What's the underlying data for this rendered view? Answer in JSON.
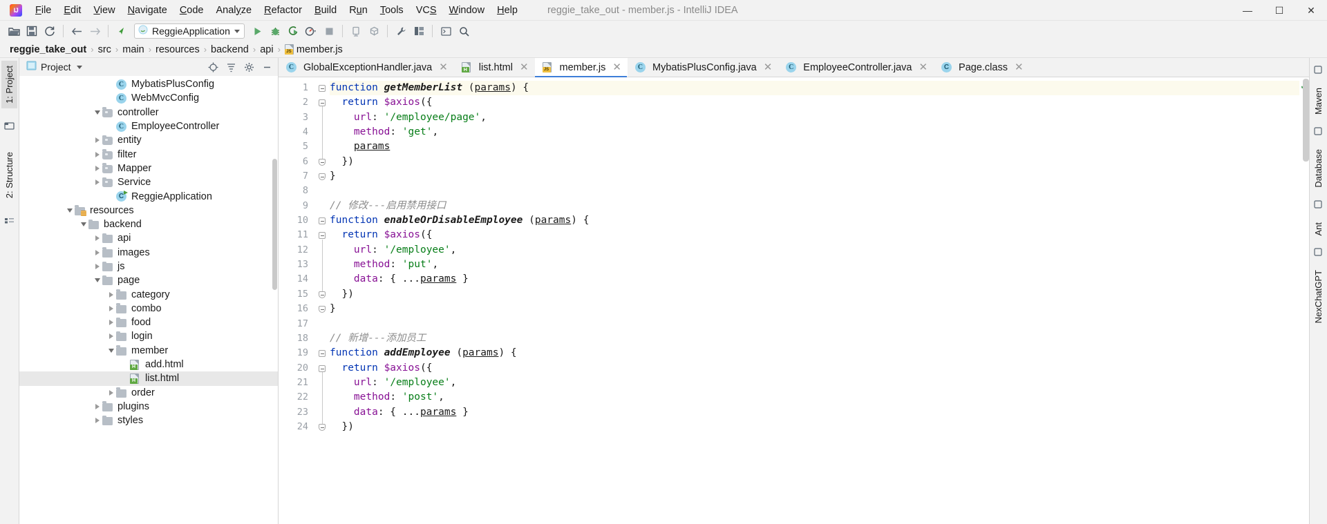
{
  "window": {
    "title": "reggie_take_out - member.js - IntelliJ IDEA",
    "logo_icon": "intellij-idea-logo",
    "minimize_label": "—",
    "maximize_label": "☐",
    "close_label": "✕"
  },
  "menubar": [
    {
      "label": "File"
    },
    {
      "label": "Edit"
    },
    {
      "label": "View"
    },
    {
      "label": "Navigate"
    },
    {
      "label": "Code"
    },
    {
      "label": "Analyze"
    },
    {
      "label": "Refactor"
    },
    {
      "label": "Build"
    },
    {
      "label": "Run"
    },
    {
      "label": "Tools"
    },
    {
      "label": "VCS"
    },
    {
      "label": "Window"
    },
    {
      "label": "Help"
    }
  ],
  "toolbar": {
    "open_icon": "open-folder-icon",
    "save_icon": "save-disk-icon",
    "sync_icon": "refresh-sync-icon",
    "back_icon": "back-arrow-icon",
    "forward_icon": "forward-arrow-icon",
    "pointer_icon": "cursor-arrow-icon",
    "run_config": "ReggieApplication",
    "run_config_icon": "spring-boot-icon",
    "run_icon": "run-play-icon",
    "debug_icon": "debug-bug-icon",
    "run_coverage_icon": "run-with-coverage-icon",
    "profile_icon": "profiler-icon",
    "stop_icon": "stop-square-icon",
    "device_icon": "device-manager-icon",
    "sdk_icon": "sdk-package-icon",
    "settings_icon": "wrench-settings-icon",
    "project_structure_icon": "project-structure-icon",
    "terminal_icon": "terminal-icon",
    "search_icon": "search-magnifier-icon"
  },
  "breadcrumb": {
    "separator": "›",
    "items": [
      {
        "label": "reggie_take_out",
        "bold": true,
        "icon": ""
      },
      {
        "label": "src",
        "bold": false,
        "icon": ""
      },
      {
        "label": "main",
        "bold": false,
        "icon": ""
      },
      {
        "label": "resources",
        "bold": false,
        "icon": ""
      },
      {
        "label": "backend",
        "bold": false,
        "icon": ""
      },
      {
        "label": "api",
        "bold": false,
        "icon": ""
      },
      {
        "label": "member.js",
        "bold": false,
        "icon": "js-file-icon"
      }
    ]
  },
  "left_strip": {
    "tabs": [
      {
        "label": "1: Project",
        "active": true
      },
      {
        "label": "2: Structure",
        "active": false
      }
    ],
    "favorites_icon": "favorites-star-icon",
    "bottom_icon": "build-variants-icon"
  },
  "right_strip": {
    "tabs": [
      {
        "label": "Maven",
        "icon": "maven-icon"
      },
      {
        "label": "Database",
        "icon": "database-icon"
      },
      {
        "label": "Ant",
        "icon": "ant-icon"
      },
      {
        "label": "NexChatGPT",
        "icon": "chatgpt-icon"
      }
    ]
  },
  "project_panel": {
    "title": "Project",
    "dropdown_icon": "chevron-down-icon",
    "locate_icon": "scroll-from-source-icon",
    "collapse_icon": "collapse-all-icon",
    "settings_icon": "gear-icon",
    "hide_icon": "hide-panel-icon",
    "tree": [
      {
        "label": "MybatisPlusConfig",
        "indent": 6,
        "icon": "java-class-icon",
        "twist": "none",
        "selected": false
      },
      {
        "label": "WebMvcConfig",
        "indent": 6,
        "icon": "java-class-icon",
        "twist": "none",
        "selected": false
      },
      {
        "label": "controller",
        "indent": 5,
        "icon": "folder-icon",
        "twist": "down",
        "selected": false
      },
      {
        "label": "EmployeeController",
        "indent": 6,
        "icon": "java-class-icon",
        "twist": "none",
        "selected": false
      },
      {
        "label": "entity",
        "indent": 5,
        "icon": "folder-icon",
        "twist": "right",
        "selected": false
      },
      {
        "label": "filter",
        "indent": 5,
        "icon": "folder-icon",
        "twist": "right",
        "selected": false
      },
      {
        "label": "Mapper",
        "indent": 5,
        "icon": "folder-icon",
        "twist": "right",
        "selected": false
      },
      {
        "label": "Service",
        "indent": 5,
        "icon": "folder-icon",
        "twist": "right",
        "selected": false
      },
      {
        "label": "ReggieApplication",
        "indent": 6,
        "icon": "spring-boot-icon",
        "twist": "none",
        "selected": false
      },
      {
        "label": "resources",
        "indent": 3,
        "icon": "resources-folder-icon",
        "twist": "down",
        "selected": false
      },
      {
        "label": "backend",
        "indent": 4,
        "icon": "folder-plain-icon",
        "twist": "down",
        "selected": false
      },
      {
        "label": "api",
        "indent": 5,
        "icon": "folder-plain-icon",
        "twist": "right",
        "selected": false
      },
      {
        "label": "images",
        "indent": 5,
        "icon": "folder-plain-icon",
        "twist": "right",
        "selected": false
      },
      {
        "label": "js",
        "indent": 5,
        "icon": "folder-plain-icon",
        "twist": "right",
        "selected": false
      },
      {
        "label": "page",
        "indent": 5,
        "icon": "folder-plain-icon",
        "twist": "down",
        "selected": false
      },
      {
        "label": "category",
        "indent": 6,
        "icon": "folder-plain-icon",
        "twist": "right",
        "selected": false
      },
      {
        "label": "combo",
        "indent": 6,
        "icon": "folder-plain-icon",
        "twist": "right",
        "selected": false
      },
      {
        "label": "food",
        "indent": 6,
        "icon": "folder-plain-icon",
        "twist": "right",
        "selected": false
      },
      {
        "label": "login",
        "indent": 6,
        "icon": "folder-plain-icon",
        "twist": "right",
        "selected": false
      },
      {
        "label": "member",
        "indent": 6,
        "icon": "folder-plain-icon",
        "twist": "down",
        "selected": false
      },
      {
        "label": "add.html",
        "indent": 7,
        "icon": "html-file-icon",
        "twist": "none",
        "selected": false
      },
      {
        "label": "list.html",
        "indent": 7,
        "icon": "html-file-icon",
        "twist": "none",
        "selected": true
      },
      {
        "label": "order",
        "indent": 6,
        "icon": "folder-plain-icon",
        "twist": "right",
        "selected": false
      },
      {
        "label": "plugins",
        "indent": 5,
        "icon": "folder-plain-icon",
        "twist": "right",
        "selected": false
      },
      {
        "label": "styles",
        "indent": 5,
        "icon": "folder-plain-icon",
        "twist": "right",
        "selected": false
      }
    ]
  },
  "editor": {
    "tabs": [
      {
        "label": "GlobalExceptionHandler.java",
        "icon": "java-class-icon",
        "active": false,
        "close_label": "✕"
      },
      {
        "label": "list.html",
        "icon": "html-file-icon",
        "active": false,
        "close_label": "✕"
      },
      {
        "label": "member.js",
        "icon": "js-file-icon",
        "active": true,
        "close_label": "✕"
      },
      {
        "label": "MybatisPlusConfig.java",
        "icon": "java-class-icon",
        "active": false,
        "close_label": "✕"
      },
      {
        "label": "EmployeeController.java",
        "icon": "java-class-icon",
        "active": false,
        "close_label": "✕"
      },
      {
        "label": "Page.class",
        "icon": "class-file-icon",
        "active": false,
        "close_label": "✕"
      }
    ],
    "inspection_status_icon": "inspection-ok-check",
    "first_line_number": 1,
    "lines": [
      {
        "n": 1,
        "fold": "minus",
        "highlight": true,
        "tokens": [
          {
            "t": "function ",
            "c": "kw"
          },
          {
            "t": "getMemberList",
            "c": "fn"
          },
          {
            "t": " (",
            "c": "pn"
          },
          {
            "t": "params",
            "c": "pm"
          },
          {
            "t": ") {",
            "c": "pn"
          }
        ],
        "indent": 0
      },
      {
        "n": 2,
        "fold": "minus",
        "highlight": false,
        "tokens": [
          {
            "t": "  return ",
            "c": "kw2"
          },
          {
            "t": "$axios",
            "c": "var"
          },
          {
            "t": "({",
            "c": "pn"
          }
        ],
        "indent": 0
      },
      {
        "n": 3,
        "fold": "",
        "highlight": false,
        "tokens": [
          {
            "t": "    ",
            "c": "pn"
          },
          {
            "t": "url",
            "c": "prop"
          },
          {
            "t": ": ",
            "c": "pn"
          },
          {
            "t": "'/employee/page'",
            "c": "str"
          },
          {
            "t": ",",
            "c": "pn"
          }
        ],
        "indent": 0
      },
      {
        "n": 4,
        "fold": "",
        "highlight": false,
        "tokens": [
          {
            "t": "    ",
            "c": "pn"
          },
          {
            "t": "method",
            "c": "prop"
          },
          {
            "t": ": ",
            "c": "pn"
          },
          {
            "t": "'get'",
            "c": "str"
          },
          {
            "t": ",",
            "c": "pn"
          }
        ],
        "indent": 0
      },
      {
        "n": 5,
        "fold": "",
        "highlight": false,
        "tokens": [
          {
            "t": "    ",
            "c": "pn"
          },
          {
            "t": "params",
            "c": "pm"
          }
        ],
        "indent": 0
      },
      {
        "n": 6,
        "fold": "minus-end",
        "highlight": false,
        "tokens": [
          {
            "t": "  })",
            "c": "pn"
          }
        ],
        "indent": 0
      },
      {
        "n": 7,
        "fold": "minus-end",
        "highlight": false,
        "tokens": [
          {
            "t": "}",
            "c": "pn"
          }
        ],
        "indent": 0
      },
      {
        "n": 8,
        "fold": "",
        "highlight": false,
        "tokens": [],
        "indent": 0
      },
      {
        "n": 9,
        "fold": "",
        "highlight": false,
        "tokens": [
          {
            "t": "// 修改---启用禁用接口",
            "c": "cmt"
          }
        ],
        "indent": 0
      },
      {
        "n": 10,
        "fold": "minus",
        "highlight": false,
        "tokens": [
          {
            "t": "function ",
            "c": "kw"
          },
          {
            "t": "enableOrDisableEmployee",
            "c": "fn"
          },
          {
            "t": " (",
            "c": "pn"
          },
          {
            "t": "params",
            "c": "pm"
          },
          {
            "t": ") {",
            "c": "pn"
          }
        ],
        "indent": 0
      },
      {
        "n": 11,
        "fold": "minus",
        "highlight": false,
        "tokens": [
          {
            "t": "  return ",
            "c": "kw2"
          },
          {
            "t": "$axios",
            "c": "var"
          },
          {
            "t": "({",
            "c": "pn"
          }
        ],
        "indent": 0
      },
      {
        "n": 12,
        "fold": "",
        "highlight": false,
        "tokens": [
          {
            "t": "    ",
            "c": "pn"
          },
          {
            "t": "url",
            "c": "prop"
          },
          {
            "t": ": ",
            "c": "pn"
          },
          {
            "t": "'/employee'",
            "c": "str"
          },
          {
            "t": ",",
            "c": "pn"
          }
        ],
        "indent": 0
      },
      {
        "n": 13,
        "fold": "",
        "highlight": false,
        "tokens": [
          {
            "t": "    ",
            "c": "pn"
          },
          {
            "t": "method",
            "c": "prop"
          },
          {
            "t": ": ",
            "c": "pn"
          },
          {
            "t": "'put'",
            "c": "str"
          },
          {
            "t": ",",
            "c": "pn"
          }
        ],
        "indent": 0
      },
      {
        "n": 14,
        "fold": "",
        "highlight": false,
        "tokens": [
          {
            "t": "    ",
            "c": "pn"
          },
          {
            "t": "data",
            "c": "prop"
          },
          {
            "t": ": { ...",
            "c": "pn"
          },
          {
            "t": "params",
            "c": "pm"
          },
          {
            "t": " }",
            "c": "pn"
          }
        ],
        "indent": 0
      },
      {
        "n": 15,
        "fold": "minus-end",
        "highlight": false,
        "tokens": [
          {
            "t": "  })",
            "c": "pn"
          }
        ],
        "indent": 0
      },
      {
        "n": 16,
        "fold": "minus-end",
        "highlight": false,
        "tokens": [
          {
            "t": "}",
            "c": "pn"
          }
        ],
        "indent": 0
      },
      {
        "n": 17,
        "fold": "",
        "highlight": false,
        "tokens": [],
        "indent": 0
      },
      {
        "n": 18,
        "fold": "",
        "highlight": false,
        "tokens": [
          {
            "t": "// 新增---添加员工",
            "c": "cmt"
          }
        ],
        "indent": 0
      },
      {
        "n": 19,
        "fold": "minus",
        "highlight": false,
        "tokens": [
          {
            "t": "function ",
            "c": "kw"
          },
          {
            "t": "addEmployee",
            "c": "fn"
          },
          {
            "t": " (",
            "c": "pn"
          },
          {
            "t": "params",
            "c": "pm"
          },
          {
            "t": ") {",
            "c": "pn"
          }
        ],
        "indent": 0
      },
      {
        "n": 20,
        "fold": "minus",
        "highlight": false,
        "tokens": [
          {
            "t": "  return ",
            "c": "kw2"
          },
          {
            "t": "$axios",
            "c": "var"
          },
          {
            "t": "({",
            "c": "pn"
          }
        ],
        "indent": 0
      },
      {
        "n": 21,
        "fold": "",
        "highlight": false,
        "tokens": [
          {
            "t": "    ",
            "c": "pn"
          },
          {
            "t": "url",
            "c": "prop"
          },
          {
            "t": ": ",
            "c": "pn"
          },
          {
            "t": "'/employee'",
            "c": "str"
          },
          {
            "t": ",",
            "c": "pn"
          }
        ],
        "indent": 0
      },
      {
        "n": 22,
        "fold": "",
        "highlight": false,
        "tokens": [
          {
            "t": "    ",
            "c": "pn"
          },
          {
            "t": "method",
            "c": "prop"
          },
          {
            "t": ": ",
            "c": "pn"
          },
          {
            "t": "'post'",
            "c": "str"
          },
          {
            "t": ",",
            "c": "pn"
          }
        ],
        "indent": 0
      },
      {
        "n": 23,
        "fold": "",
        "highlight": false,
        "tokens": [
          {
            "t": "    ",
            "c": "pn"
          },
          {
            "t": "data",
            "c": "prop"
          },
          {
            "t": ": { ...",
            "c": "pn"
          },
          {
            "t": "params",
            "c": "pm"
          },
          {
            "t": " }",
            "c": "pn"
          }
        ],
        "indent": 0
      },
      {
        "n": 24,
        "fold": "minus-end",
        "highlight": false,
        "tokens": [
          {
            "t": "  })",
            "c": "pn"
          }
        ],
        "indent": 0
      }
    ]
  },
  "colors": {
    "accent": "#3d7dd8",
    "keyword": "#0033b3",
    "string": "#067d17",
    "property": "#871094",
    "comment": "#8c8c8c",
    "selection": "#e8e8e8",
    "current_line": "#fcfaed",
    "ok_green": "#59a869"
  }
}
